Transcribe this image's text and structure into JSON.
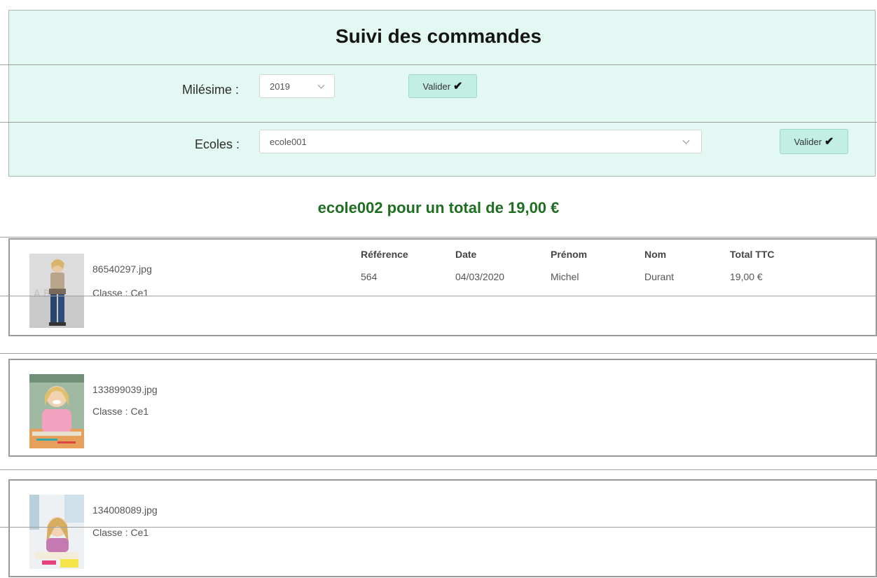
{
  "page": {
    "title": "Suivi des commandes"
  },
  "filters": {
    "millesime": {
      "label": "Milésime :",
      "value": "2019",
      "button": "Valider"
    },
    "ecoles": {
      "label": "Ecoles :",
      "value": "ecole001",
      "button": "Valider"
    }
  },
  "summary": "ecole002 pour un total de 19,00 €",
  "table_headers": [
    "Référence",
    "Date",
    "Prénom",
    "Nom",
    "Total TTC"
  ],
  "orders": [
    {
      "filename": "86540297.jpg",
      "classe": "Classe : Ce1",
      "row": [
        "564",
        "04/03/2020",
        "Michel",
        "Durant",
        "19,00 €"
      ]
    },
    {
      "filename": "133899039.jpg",
      "classe": "Classe : Ce1"
    },
    {
      "filename": "134008089.jpg",
      "classe": "Classe : Ce1"
    }
  ],
  "colors": {
    "panel": "#e3f8f3",
    "button": "#c3eee4",
    "summary": "#1f6e22"
  }
}
